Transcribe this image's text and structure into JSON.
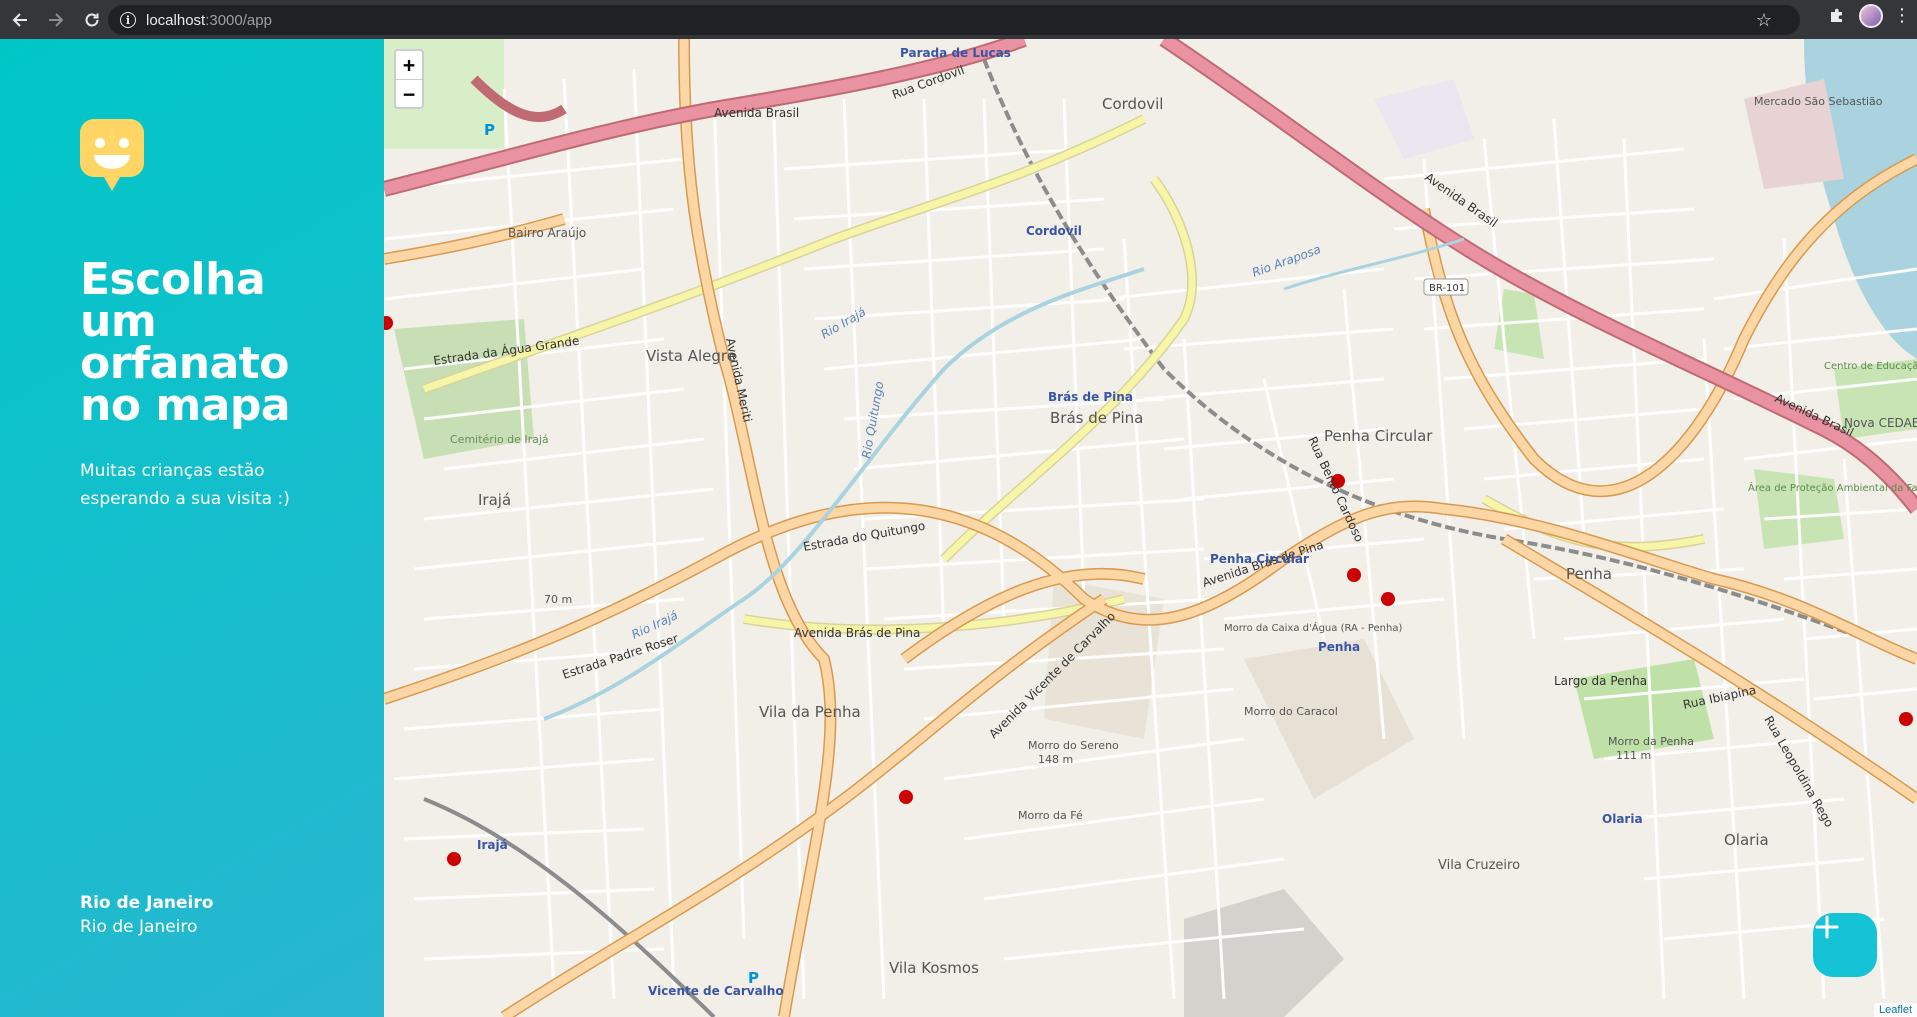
{
  "browser": {
    "url_host": "localhost",
    "url_path": ":3000/app"
  },
  "sidebar": {
    "heading_lines": [
      "Escolha",
      "um",
      "orfanato",
      "no mapa"
    ],
    "subtext": "Muitas crianças estão esperando a sua visita :)",
    "city": "Rio de Janeiro",
    "state": "Rio de Janeiro"
  },
  "map": {
    "zoom_in": "+",
    "zoom_out": "−",
    "attribution": "Leaflet",
    "labels": {
      "vista_alegre": "Vista Alegre",
      "bras_de_pina": "Brás de Pina",
      "penha_circular": "Penha Circular",
      "penha": "Penha",
      "vila_da_penha": "Vila da Penha",
      "iraja": "Irajá",
      "vila_kosmos": "Vila Kosmos",
      "vila_cruzeiro": "Vila Cruzeiro",
      "olaria": "Olaria",
      "cordovil": "Cordovil",
      "bairro_araujo": "Bairro Araújo",
      "av_brasil": "Avenida Brasil",
      "estrada_agua_grande": "Estrada da Água Grande",
      "av_bras_de_pina": "Avenida Brás de Pina",
      "estrada_quitungo": "Estrada do Quitungo",
      "rua_cordovil": "Rua Cordovil",
      "av_meriti": "Avenida Meriti",
      "av_vicente_carvalho": "Avenida Vicente de Carvalho",
      "estrada_padre_roser": "Estrada Padre Roser",
      "rua_ibiapina": "Rua Ibiapina",
      "largo_penha": "Largo da Penha",
      "mercado": "Mercado São Sebastião",
      "br101": "BR-101",
      "parada_lucas": "Parada de Lucas",
      "penha_circular_station": "Penha Circular",
      "bras_de_pina_station": "Brás de Pina",
      "penha_station": "Penha",
      "olaria_station": "Olaria",
      "vicente_carvalho_station": "Vicente de Carvalho",
      "cordovil_station": "Cordovil",
      "iraja_station": "Irajá",
      "cemiterio": "Cemitério de Irajá",
      "morro_sereno": "Morro do Sereno",
      "morro_sereno_alt": "148 m",
      "morro_penha": "Morro da Penha",
      "morro_penha_alt": "111 m",
      "morro_fe": "Morro da Fé",
      "morro_caracol": "Morro do Caracol",
      "area_protecao": "Área de Proteção Ambiental da Fazendinha da Penha",
      "centro_educacao": "Centro de Educação Físico Almirante Adalberto Nunes",
      "nova_cedae": "Nova CEDAE",
      "rio_iraja": "Rio Irajá",
      "rua_bento_cardoso": "Rua Bento Cardoso",
      "rua_leopoldina_rego": "Rua Leopoldina Rego",
      "morro_caixa": "Morro da Caixa d'Água (RA - Penha)",
      "rio_quitungo": "Rio Quitungo",
      "rio_araposa": "Rio Araposa",
      "m70": "70 m"
    }
  },
  "colors": {
    "sidebar_start": "#29B6D1",
    "sidebar_end": "#00C7C7",
    "logo": "#FFD666",
    "fab": "#15C3D6",
    "road_major": "#f8b96d",
    "road_trunk": "#e8929a",
    "road_secondary": "#f7f5a8"
  },
  "icons": {
    "back": "arrow-left-icon",
    "forward": "arrow-right-icon",
    "reload": "reload-icon",
    "info": "info-icon",
    "star": "star-icon",
    "extensions": "puzzle-icon",
    "profile": "avatar",
    "menu": "kebab-icon",
    "logo": "smiley-pin-logo",
    "add": "plus-icon"
  }
}
